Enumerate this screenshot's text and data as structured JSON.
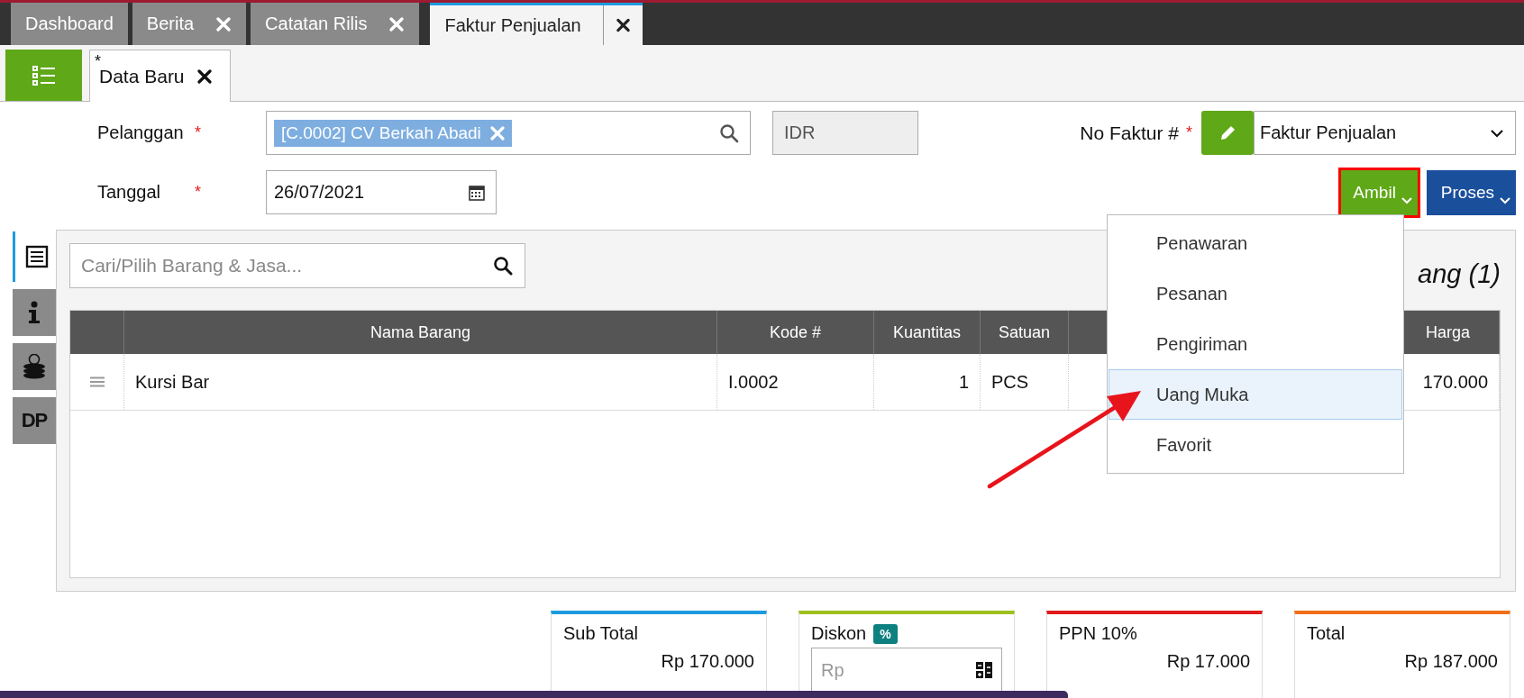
{
  "tabs": [
    {
      "label": "Dashboard",
      "closable": false,
      "selected": false
    },
    {
      "label": "Berita",
      "closable": true,
      "selected": false
    },
    {
      "label": "Catatan Rilis",
      "closable": true,
      "selected": false
    },
    {
      "label": "Faktur Penjualan",
      "closable": true,
      "selected": true
    }
  ],
  "subtabs": [
    {
      "label": "Data Baru",
      "modified_mark": "*",
      "selected": true
    }
  ],
  "form": {
    "customer": {
      "label": "Pelanggan",
      "required_mark": "*",
      "chip": "[C.0002] CV Berkah Abadi"
    },
    "currency": "IDR",
    "date": {
      "label": "Tanggal",
      "required_mark": "*",
      "value": "26/07/2021"
    },
    "invoice_no": {
      "label": "No Faktur #",
      "required_mark": "*",
      "value": "Faktur Penjualan"
    }
  },
  "actions": [
    {
      "label": "Ambil",
      "color": "#5fa818",
      "highlighted": true
    },
    {
      "label": "Proses",
      "color": "#1a4f9c",
      "highlighted": false
    }
  ],
  "dropdown": {
    "items": [
      {
        "label": "Penawaran",
        "selected": false
      },
      {
        "label": "Pesanan",
        "selected": false
      },
      {
        "label": "Pengiriman",
        "selected": false
      },
      {
        "label": "Uang Muka",
        "selected": true
      },
      {
        "label": "Favorit",
        "selected": false
      }
    ]
  },
  "pointer_arrow": true,
  "side_tabs": [
    {
      "kind": "list",
      "selected": true
    },
    {
      "kind": "info",
      "selected": false
    },
    {
      "kind": "coins",
      "selected": false
    },
    {
      "kind": "text",
      "label": "DP",
      "selected": false
    }
  ],
  "item_search": {
    "placeholder": "Cari/Pilih Barang & Jasa..."
  },
  "item_count_title": "ang (1)",
  "table": {
    "columns": [
      "Nama Barang",
      "Kode #",
      "Kuantitas",
      "Satuan",
      "Harga"
    ],
    "rows": [
      {
        "cells": [
          "Kursi Bar",
          "I.0002",
          "1",
          "PCS",
          "170.000"
        ]
      }
    ]
  },
  "summary": [
    {
      "kind": "value",
      "label": "Sub Total",
      "value": "Rp 170.000",
      "color": "#1e9be0"
    },
    {
      "kind": "input",
      "label": "Diskon",
      "badge": "%",
      "placeholder": "Rp",
      "color": "#9dc01c"
    },
    {
      "kind": "value",
      "label": "PPN 10%",
      "value": "Rp 17.000",
      "color": "#e01b1b"
    },
    {
      "kind": "value",
      "label": "Total",
      "value": "Rp 187.000",
      "color": "#f07018"
    }
  ]
}
